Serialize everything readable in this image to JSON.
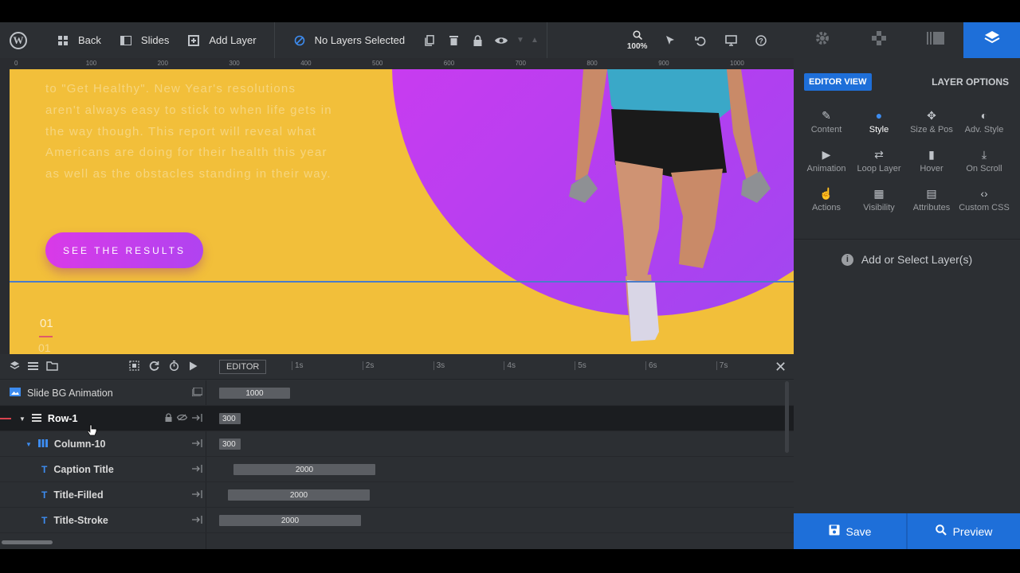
{
  "toolbar": {
    "back_label": "Back",
    "slides_label": "Slides",
    "add_layer_label": "Add Layer",
    "no_layers_label": "No Layers Selected",
    "zoom_level": "100%"
  },
  "canvas": {
    "paragraph": "to \"Get Healthy\". New Year's resolutions aren't always easy to stick to when life gets in the way though. This report will reveal what Americans are doing for their health this year as well as the obstacles standing in their way.",
    "cta_label": "SEE THE RESULTS",
    "slide_number": "01",
    "slide_number_ghost": "01",
    "accent_color": "#f2bf3a",
    "circle_color": "#c23cf0"
  },
  "ruler": {
    "ticks": [
      "0",
      "100",
      "200",
      "300",
      "400",
      "500",
      "600",
      "700",
      "800",
      "900",
      "1000"
    ]
  },
  "right_panel": {
    "editor_view": "EDITOR VIEW",
    "layer_options": "LAYER OPTIONS",
    "options": [
      {
        "label": "Content",
        "icon": "pencil-icon"
      },
      {
        "label": "Style",
        "icon": "palette-icon"
      },
      {
        "label": "Size & Pos",
        "icon": "move-icon"
      },
      {
        "label": "Adv. Style",
        "icon": "contrast-icon"
      },
      {
        "label": "Animation",
        "icon": "play-icon"
      },
      {
        "label": "Loop Layer",
        "icon": "loop-icon"
      },
      {
        "label": "Hover",
        "icon": "mouse-icon"
      },
      {
        "label": "On Scroll",
        "icon": "download-icon"
      },
      {
        "label": "Actions",
        "icon": "hand-pointer-icon"
      },
      {
        "label": "Visibility",
        "icon": "visibility-icon"
      },
      {
        "label": "Attributes",
        "icon": "file-icon"
      },
      {
        "label": "Custom CSS",
        "icon": "code-icon"
      }
    ],
    "add_select": "Add or Select Layer(s)",
    "save_label": "Save",
    "preview_label": "Preview"
  },
  "timeline": {
    "editor_tag": "EDITOR",
    "seconds": [
      "1s",
      "2s",
      "3s",
      "4s",
      "5s",
      "6s",
      "7s"
    ],
    "rows": [
      {
        "name": "Slide BG Animation",
        "duration": "1000"
      },
      {
        "name": "Row-1",
        "duration": "300"
      },
      {
        "name": "Column-10",
        "duration": "300"
      },
      {
        "name": "Caption Title",
        "duration": "2000"
      },
      {
        "name": "Title-Filled",
        "duration": "2000"
      },
      {
        "name": "Title-Stroke",
        "duration": "2000"
      }
    ]
  }
}
